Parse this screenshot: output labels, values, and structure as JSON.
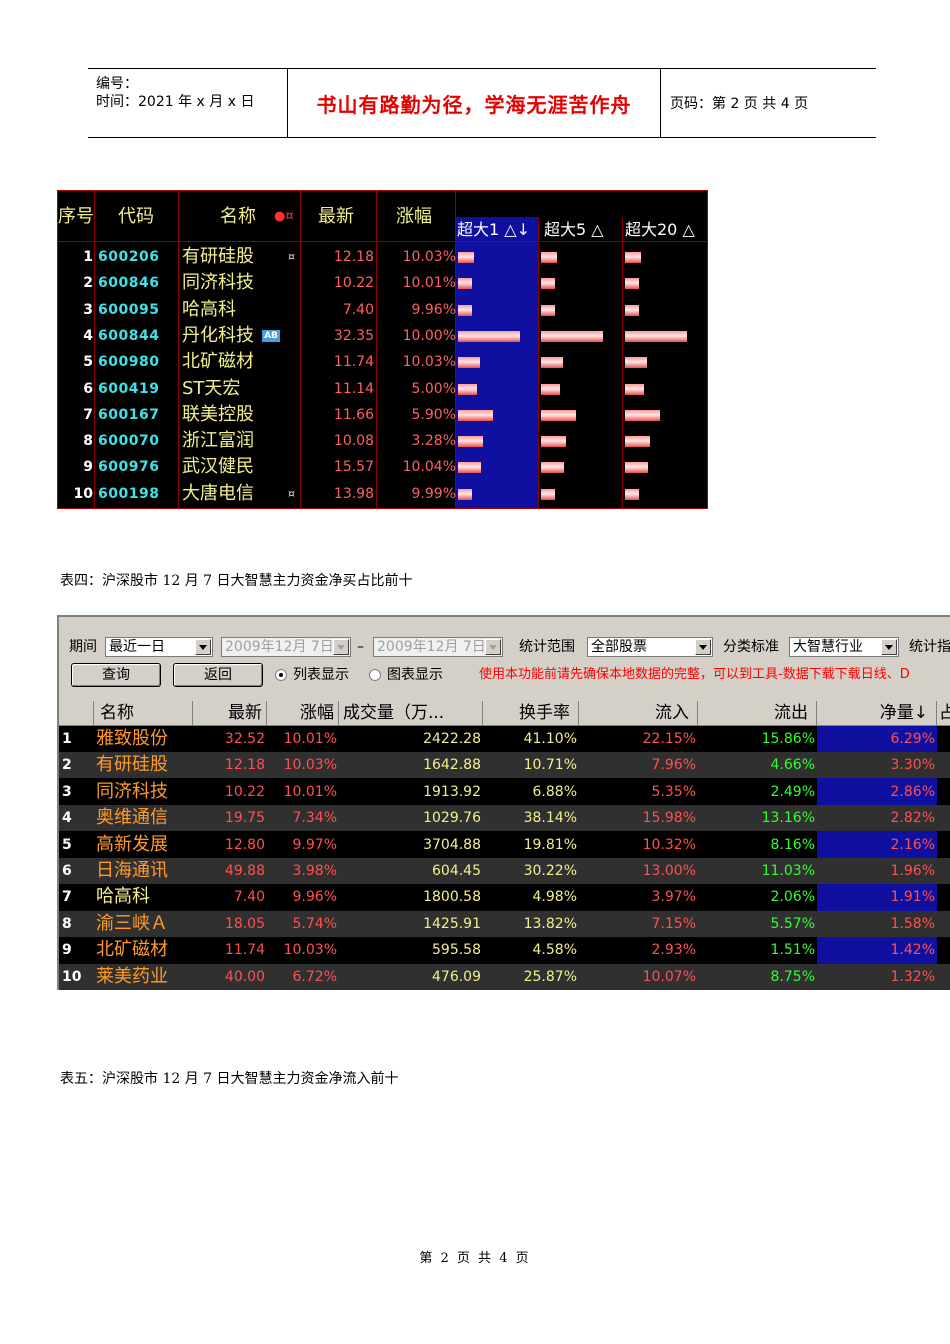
{
  "header": {
    "serial_label": "编号：",
    "time_label": "时间：2021 年 x 月 x 日",
    "motto": "书山有路勤为径，学海无涯苦作舟",
    "page_label": "页码：第 2 页  共 4 页"
  },
  "table1": {
    "columns": [
      "序号",
      "代码",
      "名称",
      "最新",
      "涨幅"
    ],
    "name_markers": "●¤",
    "sub_columns": [
      "超大1 △↓",
      "超大5 △",
      "超大20 △"
    ],
    "rows": [
      {
        "idx": "1",
        "code": "600206",
        "name": "有研硅股",
        "mark": "¤",
        "price": "12.18",
        "pct": "10.03%",
        "bars": [
          0.2,
          0.2,
          0.2
        ]
      },
      {
        "idx": "2",
        "code": "600846",
        "name": "同济科技",
        "mark": "",
        "price": "10.22",
        "pct": "10.01%",
        "bars": [
          0.17,
          0.17,
          0.17
        ]
      },
      {
        "idx": "3",
        "code": "600095",
        "name": "哈高科",
        "mark": "",
        "price": "7.40",
        "pct": "9.96%",
        "bars": [
          0.17,
          0.17,
          0.17
        ]
      },
      {
        "idx": "4",
        "code": "600844",
        "name": "丹化科技",
        "mark": "AB",
        "price": "32.35",
        "pct": "10.00%",
        "bars": [
          0.77,
          0.77,
          0.77
        ]
      },
      {
        "idx": "5",
        "code": "600980",
        "name": "北矿磁材",
        "mark": "",
        "price": "11.74",
        "pct": "10.03%",
        "bars": [
          0.27,
          0.27,
          0.27
        ]
      },
      {
        "idx": "6",
        "code": "600419",
        "name": "ST天宏",
        "mark": "",
        "price": "11.14",
        "pct": "5.00%",
        "bars": [
          0.24,
          0.24,
          0.24
        ]
      },
      {
        "idx": "7",
        "code": "600167",
        "name": "联美控股",
        "mark": "",
        "price": "11.66",
        "pct": "5.90%",
        "bars": [
          0.44,
          0.44,
          0.44
        ]
      },
      {
        "idx": "8",
        "code": "600070",
        "name": "浙江富润",
        "mark": "",
        "price": "10.08",
        "pct": "3.28%",
        "bars": [
          0.31,
          0.31,
          0.31
        ]
      },
      {
        "idx": "9",
        "code": "600976",
        "name": "武汉健民",
        "mark": "",
        "price": "15.57",
        "pct": "10.04%",
        "bars": [
          0.29,
          0.29,
          0.29
        ]
      },
      {
        "idx": "10",
        "code": "600198",
        "name": "大唐电信",
        "mark": "¤",
        "price": "13.98",
        "pct": "9.99%",
        "bars": [
          0.17,
          0.17,
          0.17
        ]
      }
    ]
  },
  "caption4": "表四：沪深股市 12 月 7 日大智慧主力资金净买占比前十",
  "table2": {
    "period_label": "期间",
    "period_value": "最近一日",
    "date_from": "2009年12月  7日",
    "dash": "–",
    "date_to": "2009年12月  7日",
    "scope_label": "统计范围",
    "scope_value": "全部股票",
    "class_label": "分类标准",
    "class_value": "大智慧行业",
    "stat_label": "统计指",
    "query_button": "查询",
    "back_button": "返回",
    "view_list": "列表显示",
    "view_chart": "图表显示",
    "notice": "使用本功能前请先确保本地数据的完整，可以到工具-数据下载下载日线、D",
    "columns": [
      "名称",
      "最新",
      "涨幅",
      "成交量（万...",
      "换手率",
      "流入",
      "流出",
      "净量↓",
      "占"
    ],
    "rows": [
      {
        "idx": "1",
        "name": "雅致股份",
        "price": "32.52",
        "pct": "10.01%",
        "vol": "2422.28",
        "turn": "41.10%",
        "in": "22.15%",
        "out": "15.86%",
        "net": "6.29%"
      },
      {
        "idx": "2",
        "name": "有研硅股",
        "price": "12.18",
        "pct": "10.03%",
        "vol": "1642.88",
        "turn": "10.71%",
        "in": "7.96%",
        "out": "4.66%",
        "net": "3.30%"
      },
      {
        "idx": "3",
        "name": "同济科技",
        "price": "10.22",
        "pct": "10.01%",
        "vol": "1913.92",
        "turn": "6.88%",
        "in": "5.35%",
        "out": "2.49%",
        "net": "2.86%"
      },
      {
        "idx": "4",
        "name": "奥维通信",
        "price": "19.75",
        "pct": "7.34%",
        "vol": "1029.76",
        "turn": "38.14%",
        "in": "15.98%",
        "out": "13.16%",
        "net": "2.82%"
      },
      {
        "idx": "5",
        "name": "高新发展",
        "price": "12.80",
        "pct": "9.97%",
        "vol": "3704.88",
        "turn": "19.81%",
        "in": "10.32%",
        "out": "8.16%",
        "net": "2.16%"
      },
      {
        "idx": "6",
        "name": "日海通讯",
        "price": "49.88",
        "pct": "3.98%",
        "vol": "604.45",
        "turn": "30.22%",
        "in": "13.00%",
        "out": "11.03%",
        "net": "1.96%"
      },
      {
        "idx": "7",
        "name": "哈高科",
        "price": "7.40",
        "pct": "9.96%",
        "vol": "1800.58",
        "turn": "4.98%",
        "in": "3.97%",
        "out": "2.06%",
        "net": "1.91%"
      },
      {
        "idx": "8",
        "name": "渝三峡Ａ",
        "price": "18.05",
        "pct": "5.74%",
        "vol": "1425.91",
        "turn": "13.82%",
        "in": "7.15%",
        "out": "5.57%",
        "net": "1.58%"
      },
      {
        "idx": "9",
        "name": "北矿磁材",
        "price": "11.74",
        "pct": "10.03%",
        "vol": "595.58",
        "turn": "4.58%",
        "in": "2.93%",
        "out": "1.51%",
        "net": "1.42%"
      },
      {
        "idx": "10",
        "name": "莱美药业",
        "price": "40.00",
        "pct": "6.72%",
        "vol": "476.09",
        "turn": "25.87%",
        "in": "10.07%",
        "out": "8.75%",
        "net": "1.32%"
      }
    ]
  },
  "caption5": "表五：沪深股市 12 月 7 日大智慧主力资金净流入前十",
  "footer": "第 2 页 共 4 页"
}
